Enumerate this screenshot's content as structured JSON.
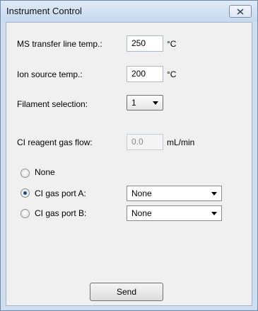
{
  "window": {
    "title": "Instrument Control"
  },
  "form": {
    "ms_transfer": {
      "label": "MS transfer line temp.:",
      "value": "250",
      "unit": "°C"
    },
    "ion_source": {
      "label": "Ion source temp.:",
      "value": "200",
      "unit": "°C"
    },
    "filament": {
      "label": "Filament selection:",
      "selected": "1"
    },
    "ci_reagent": {
      "label": "CI reagent gas flow:",
      "value": "0.0",
      "unit": "mL/min"
    },
    "radios": {
      "none_label": "None",
      "port_a_label": "CI gas port A:",
      "port_b_label": "CI gas port B:",
      "selected": "port_a"
    },
    "port_a_select": "None",
    "port_b_select": "None"
  },
  "buttons": {
    "send": "Send"
  },
  "icons": {
    "close": "close-icon",
    "dropdown": "chevron-down-icon"
  }
}
